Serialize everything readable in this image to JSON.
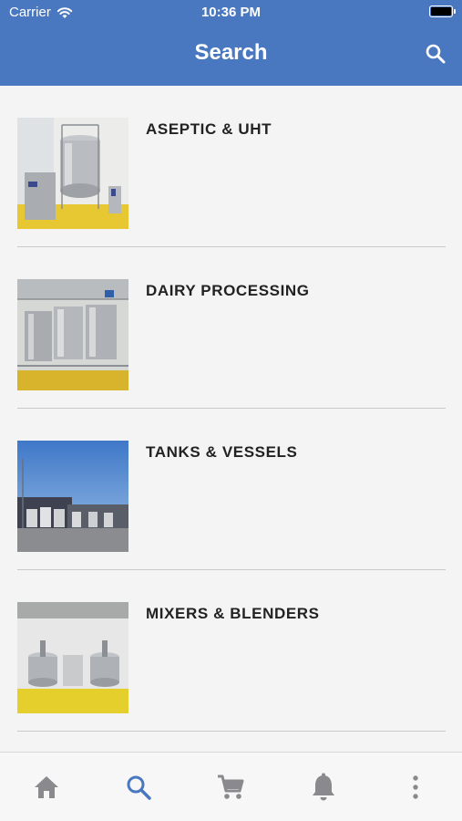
{
  "status": {
    "carrier": "Carrier",
    "time": "10:36 PM"
  },
  "header": {
    "title": "Search"
  },
  "categories": [
    {
      "label": "ASEPTIC & UHT"
    },
    {
      "label": "DAIRY PROCESSING"
    },
    {
      "label": "TANKS & VESSELS"
    },
    {
      "label": "MIXERS & BLENDERS"
    }
  ],
  "tabs": [
    {
      "icon": "home-icon",
      "active": false
    },
    {
      "icon": "search-icon",
      "active": true
    },
    {
      "icon": "cart-icon",
      "active": false
    },
    {
      "icon": "bell-icon",
      "active": false
    },
    {
      "icon": "more-vertical-icon",
      "active": false
    }
  ],
  "colors": {
    "header": "#4a78c0",
    "active_tab": "#4a78c0",
    "inactive_tab": "#8a8a8e"
  }
}
